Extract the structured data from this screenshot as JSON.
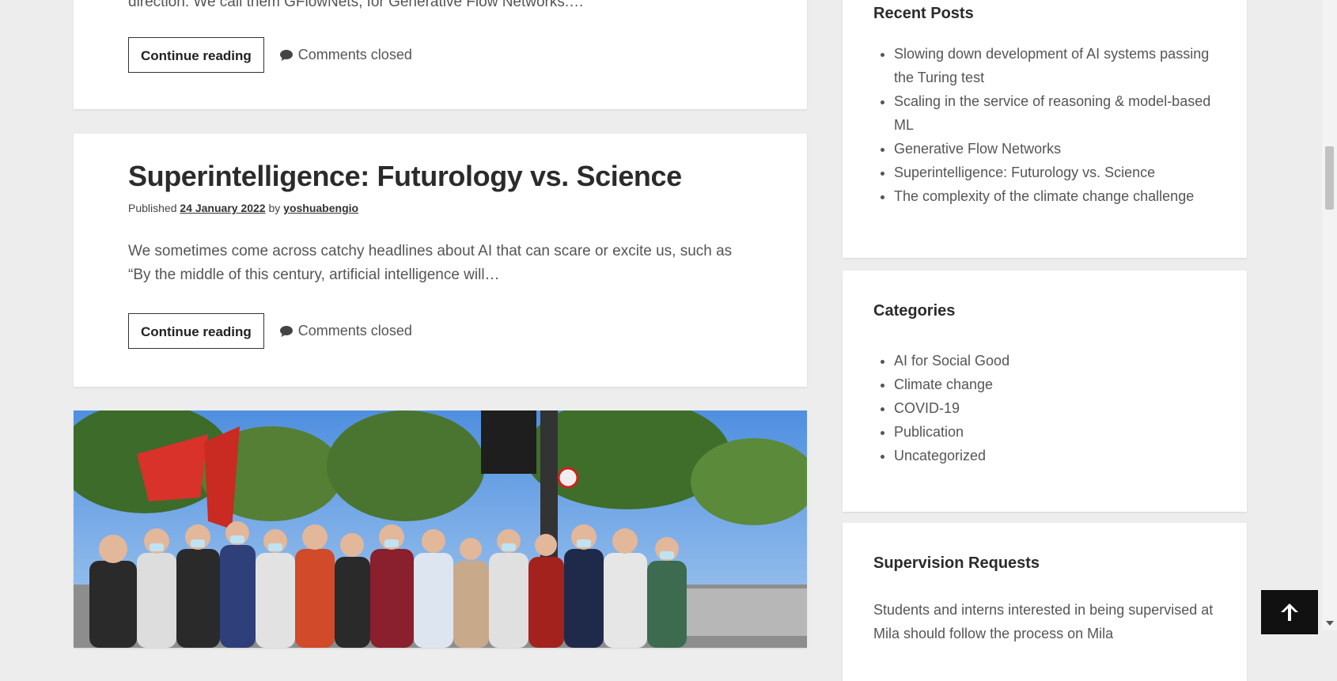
{
  "post1": {
    "excerpt_tail": "direction. We call them GFlowNets, for Generative Flow Networks.…",
    "continue_label": "Continue reading",
    "comments_label": "Comments closed"
  },
  "post2": {
    "title": "Superintelligence: Futurology vs. Science",
    "published_label": "Published",
    "date": "24 January 2022",
    "by_label": "by",
    "author": "yoshuabengio",
    "excerpt": "We sometimes come across catchy headlines about AI that can scare or excite us, such as “By the middle of this century, artificial intelligence will…",
    "continue_label": "Continue reading",
    "comments_label": "Comments closed"
  },
  "post3": {
    "image_icon": "photo-crowd-climate-march"
  },
  "sidebar": {
    "recent_posts": {
      "title": "Recent Posts",
      "items": [
        "Slowing down development of AI systems passing the Turing test",
        "Scaling in the service of reasoning & model-based ML",
        "Generative Flow Networks",
        "Superintelligence: Futurology vs. Science",
        "The complexity of the climate change challenge"
      ]
    },
    "categories": {
      "title": "Categories",
      "items": [
        "AI for Social Good",
        "Climate change",
        "COVID-19",
        "Publication",
        "Uncategorized"
      ]
    },
    "supervision": {
      "title": "Supervision Requests",
      "text": "Students and interns interested in being supervised at Mila should follow the process on Mila"
    }
  },
  "colors": {
    "background": "#ededed",
    "card": "#ffffff",
    "text": "#333333",
    "back_to_top": "#111111"
  },
  "icons": {
    "comment": "speech-bubble-icon",
    "back_to_top": "arrow-up-icon"
  }
}
